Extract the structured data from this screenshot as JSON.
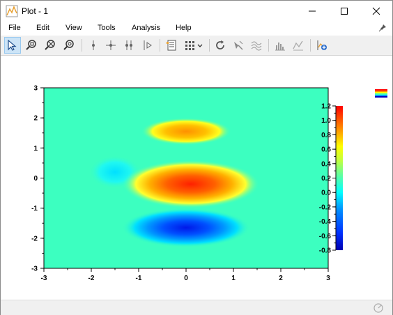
{
  "window": {
    "title": "Plot - 1"
  },
  "menubar": {
    "items": [
      {
        "name": "menu-file",
        "label": "File"
      },
      {
        "name": "menu-edit",
        "label": "Edit"
      },
      {
        "name": "menu-view",
        "label": "View"
      },
      {
        "name": "menu-tools",
        "label": "Tools"
      },
      {
        "name": "menu-analysis",
        "label": "Analysis"
      },
      {
        "name": "menu-help",
        "label": "Help"
      }
    ]
  },
  "toolbar": {
    "tools": [
      "select-pointer-icon",
      "zoom-region-icon",
      "zoom-out-icon",
      "zoom-in-icon",
      "vertical-cursor-icon",
      "crosshair-cursor-icon",
      "dual-cursor-icon",
      "peak-cursor-icon",
      "data-table-icon",
      "layout-grid-icon",
      "refresh-icon",
      "clear-markers-icon",
      "waterfall-icon",
      "histogram-icon",
      "fit-curve-icon",
      "export-image-icon"
    ]
  },
  "colors": {
    "colormap": [
      "#0000a8",
      "#0000ff",
      "#0080ff",
      "#00ffff",
      "#40ffc0",
      "#80ff80",
      "#ffff00",
      "#ff8000",
      "#ff0000",
      "#a00000"
    ],
    "background": "#3cffc0"
  },
  "chart_data": {
    "type": "heatmap",
    "title": "",
    "xlabel": "",
    "ylabel": "",
    "xlim": [
      -3,
      3
    ],
    "ylim": [
      -3,
      3
    ],
    "x_ticks": [
      "-3",
      "-2",
      "-1",
      "0",
      "1",
      "2",
      "3"
    ],
    "y_ticks": [
      "3",
      "2",
      "1",
      "0",
      "-1",
      "-2",
      "-3"
    ],
    "colorbar": {
      "range": [
        -0.8,
        1.2
      ],
      "ticks": [
        "1.2",
        "1.0",
        "0.8",
        "0.6",
        "0.4",
        "0.2",
        "0.0",
        "-0.2",
        "-0.4",
        "-0.6",
        "-0.8"
      ]
    },
    "features": [
      {
        "x": 0.0,
        "y": 1.55,
        "value": 0.75
      },
      {
        "x": 0.1,
        "y": -0.2,
        "value": 1.05
      },
      {
        "x": 0.0,
        "y": -1.65,
        "value": -0.75
      },
      {
        "x": -1.5,
        "y": 0.2,
        "value": -0.15
      }
    ]
  }
}
